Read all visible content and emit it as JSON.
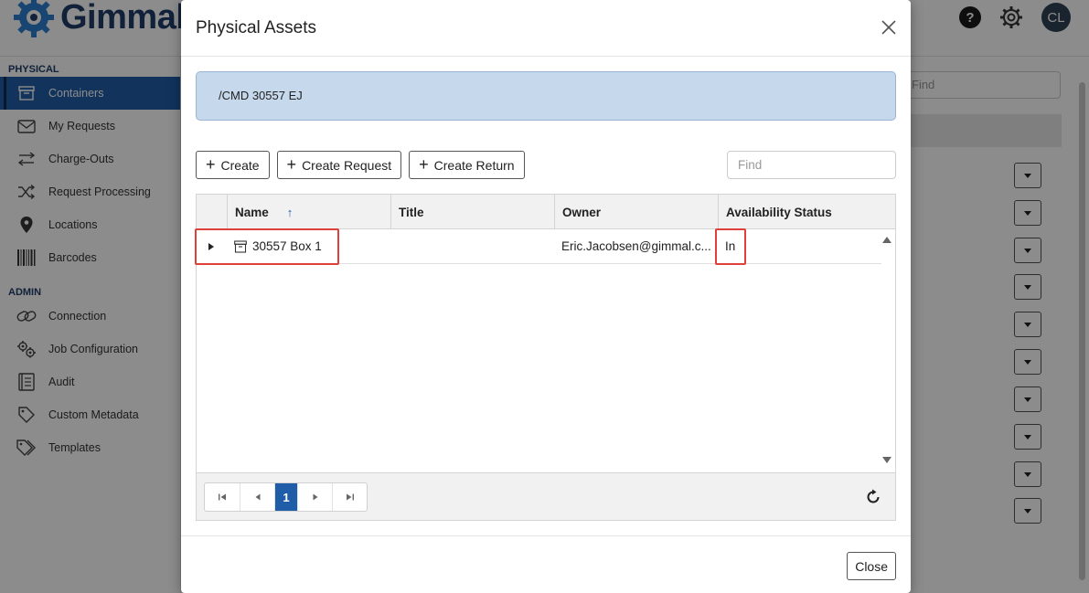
{
  "app": {
    "brand": "Gimmal",
    "help_label": "?",
    "avatar_initials": "CL"
  },
  "sidebar": {
    "physical_label": "PHYSICAL",
    "admin_label": "ADMIN",
    "physical_items": [
      {
        "label": "Containers",
        "icon": "archive-box-icon",
        "active": true
      },
      {
        "label": "My Requests",
        "icon": "envelope-icon"
      },
      {
        "label": "Charge-Outs",
        "icon": "swap-arrows-icon"
      },
      {
        "label": "Request Processing",
        "icon": "shuffle-icon"
      },
      {
        "label": "Locations",
        "icon": "map-pin-icon"
      },
      {
        "label": "Barcodes",
        "icon": "barcode-icon"
      }
    ],
    "admin_items": [
      {
        "label": "Connection",
        "icon": "link-icon"
      },
      {
        "label": "Job Configuration",
        "icon": "gears-icon"
      },
      {
        "label": "Audit",
        "icon": "audit-book-icon"
      },
      {
        "label": "Custom Metadata",
        "icon": "tag-icon"
      },
      {
        "label": "Templates",
        "icon": "tags-icon"
      }
    ]
  },
  "background": {
    "find_placeholder": "Find"
  },
  "modal": {
    "title": "Physical Assets",
    "path": "/CMD 30557 EJ",
    "toolbar": {
      "create": "Create",
      "create_request": "Create Request",
      "create_return": "Create Return",
      "find_placeholder": "Find"
    },
    "grid": {
      "columns": [
        "Name",
        "Title",
        "Owner",
        "Availability Status"
      ],
      "sort_column": "Name",
      "sort_direction": "ascending",
      "rows": [
        {
          "name": "30557 Box 1",
          "title": "",
          "owner": "Eric.Jacobsen@gimmal.c...",
          "availability": "In"
        }
      ]
    },
    "pager": {
      "current_page": "1"
    },
    "footer": {
      "close": "Close"
    }
  }
}
